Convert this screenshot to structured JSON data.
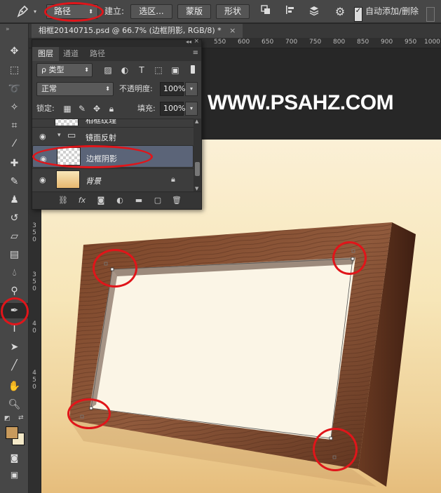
{
  "options_bar": {
    "tool_icon": "pen-icon",
    "mode_value": "路径",
    "make_label": "建立:",
    "selection_btn": "选区...",
    "mask_btn": "蒙版",
    "shape_btn": "形状",
    "auto_add_delete": "自动添加/删除",
    "auto_add_checked": true,
    "check_mark": "✓"
  },
  "document": {
    "tab_title": "相框20140715.psd @ 66.7% (边框阴影, RGB/8) *",
    "tab_close": "×",
    "ruler_ticks": [
      "550",
      "600",
      "650",
      "700",
      "750",
      "800",
      "850",
      "900",
      "950",
      "1000"
    ],
    "left_ruler_ticks": [
      "3",
      "5",
      "0",
      "3",
      "5",
      "0",
      "4",
      "0",
      "4",
      "5",
      "0"
    ],
    "watermark": "WWW.PSAHZ.COM"
  },
  "layers_panel": {
    "collapse": "◂◂",
    "close": "×",
    "menu": "≡",
    "tabs": [
      "图层",
      "通道",
      "路径"
    ],
    "active_tab": 0,
    "filter_label": "ρ 类型",
    "blend_mode": "正常",
    "opacity_label": "不透明度:",
    "opacity_value": "100%",
    "lock_label": "锁定:",
    "fill_label": "填充:",
    "fill_value": "100%",
    "layers": [
      {
        "name": "相框纹理",
        "type": "layer",
        "visible": true
      },
      {
        "name": "镜面反射",
        "type": "group",
        "visible": true
      },
      {
        "name": "边框阴影",
        "type": "layer",
        "visible": true,
        "selected": true
      },
      {
        "name": "背景",
        "type": "background",
        "visible": true,
        "locked": true
      }
    ],
    "footer_icons": [
      "link-icon",
      "fx-icon",
      "mask-icon",
      "adjustment-icon",
      "folder-icon",
      "new-layer-icon",
      "trash-icon"
    ]
  },
  "toolbar": {
    "active_tool": "pen-tool",
    "foreground_color": "#c89a5c",
    "background_color": "#f4e9c8"
  },
  "colors": {
    "annotation_red": "#e0151a",
    "wood_dark": "#5a2f1c",
    "wood_mid": "#8a5236",
    "canvas_top": "#fbf0d6",
    "canvas_bottom": "#e6bd7c"
  }
}
